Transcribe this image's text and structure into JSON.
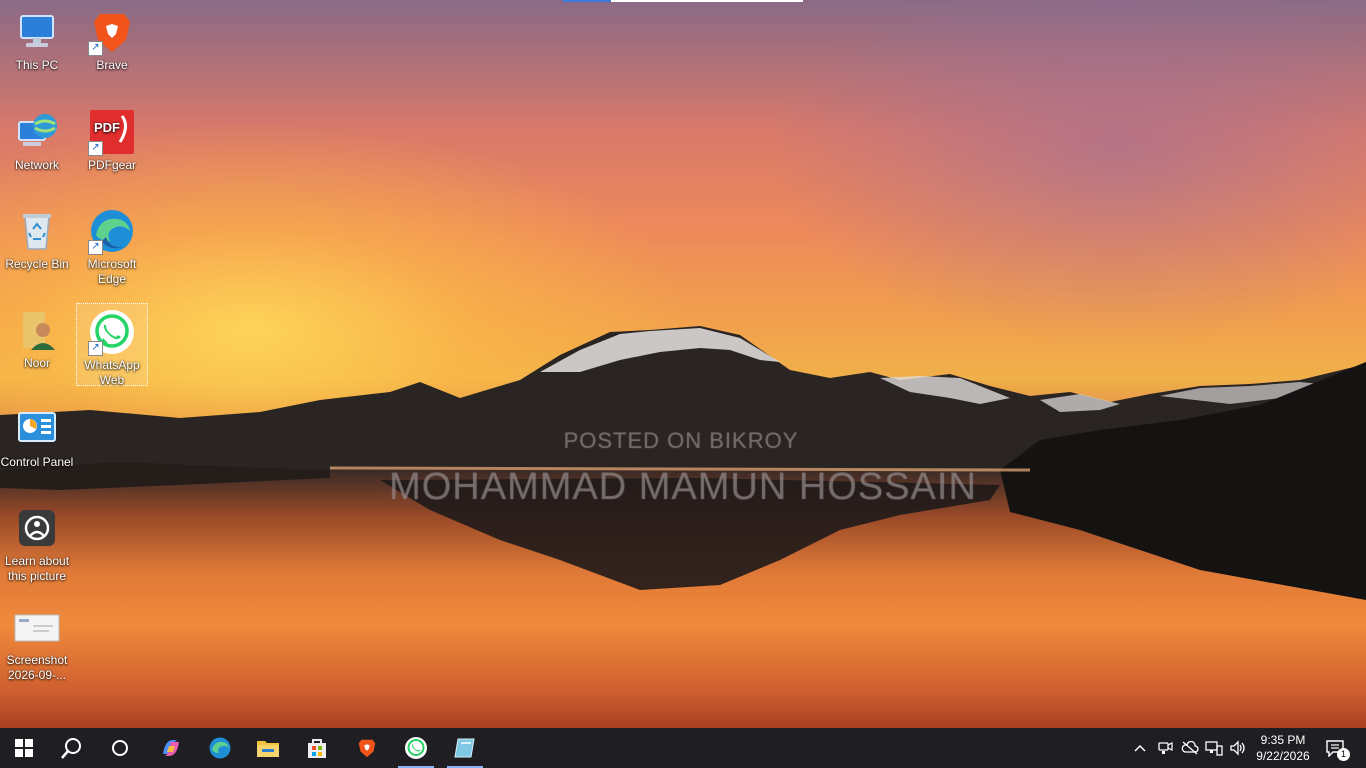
{
  "desktop": {
    "watermark_line1": "POSTED ON BIKROY",
    "watermark_line2": "MOHAMMAD MAMUN HOSSAIN",
    "icons": [
      {
        "label": "This PC",
        "icon": "computer-icon"
      },
      {
        "label": "Brave",
        "icon": "brave-icon"
      },
      {
        "label": "Network",
        "icon": "network-icon"
      },
      {
        "label": "PDFgear",
        "icon": "pdfgear-icon"
      },
      {
        "label": "Recycle Bin",
        "icon": "recycle-bin-icon"
      },
      {
        "label": "Microsoft Edge",
        "icon": "edge-icon"
      },
      {
        "label": "Noor",
        "icon": "user-folder-icon"
      },
      {
        "label": "WhatsApp Web",
        "icon": "whatsapp-icon"
      },
      {
        "label": "Control Panel",
        "icon": "control-panel-icon"
      },
      {
        "label": "Learn about this picture",
        "icon": "learn-picture-icon"
      },
      {
        "label": "Screenshot 2026-09-...",
        "icon": "screenshot-file-icon"
      }
    ]
  },
  "taskbar": {
    "buttons": [
      {
        "name": "start",
        "icon": "windows-logo-icon"
      },
      {
        "name": "search",
        "icon": "search-icon"
      },
      {
        "name": "cortana",
        "icon": "cortana-icon"
      },
      {
        "name": "copilot",
        "icon": "copilot-icon"
      },
      {
        "name": "edge",
        "icon": "edge-icon"
      },
      {
        "name": "file-explorer",
        "icon": "folder-icon"
      },
      {
        "name": "microsoft-store",
        "icon": "store-icon"
      },
      {
        "name": "brave",
        "icon": "brave-icon"
      },
      {
        "name": "whatsapp",
        "icon": "whatsapp-icon"
      },
      {
        "name": "notepad-app",
        "icon": "app-icon"
      }
    ],
    "tray": {
      "time": "9:35 PM",
      "date": "9/22/2026",
      "notifications_count": "1"
    }
  },
  "colors": {
    "taskbar_bg": "#1f1f23",
    "active_indicator": "#8ab4f8"
  }
}
